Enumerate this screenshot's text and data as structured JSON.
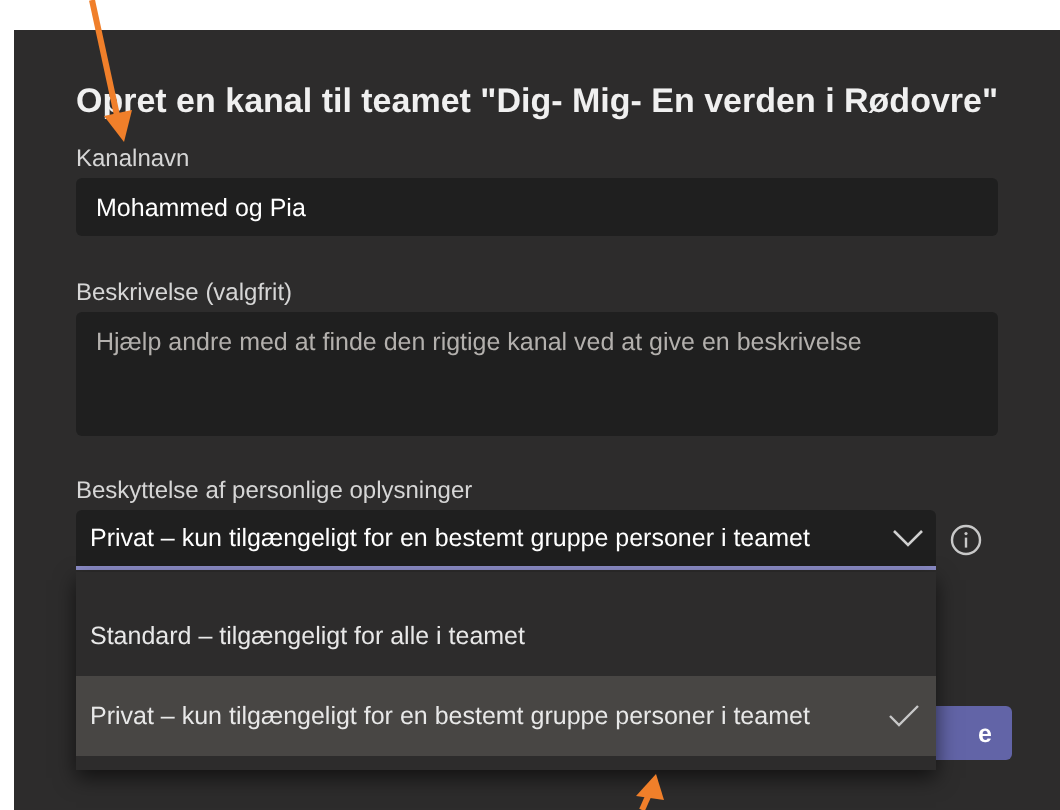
{
  "dialog": {
    "title": "Opret en kanal til teamet \"Dig- Mig- En verden i Rødovre\"",
    "fields": [
      {
        "kind": "text",
        "label": "Kanalnavn",
        "value": "Mohammed og Pia"
      },
      {
        "kind": "textarea",
        "label": "Beskrivelse (valgfrit)",
        "placeholder": "Hjælp andre med at finde den rigtige kanal ved at give en beskrivelse"
      },
      {
        "kind": "select",
        "label": "Beskyttelse af personlige oplysninger",
        "value": "Privat – kun tilgængeligt for en bestemt gruppe personer i teamet",
        "expanded": true,
        "options": [
          {
            "label": "Standard – tilgængeligt for alle i teamet",
            "selected": false
          },
          {
            "label": "Privat – kun tilgængeligt for en bestemt gruppe personer i teamet",
            "selected": true
          }
        ]
      }
    ],
    "button": {
      "label": "e"
    }
  },
  "annotations": [
    {
      "kind": "arrow"
    },
    {
      "kind": "arrow"
    }
  ]
}
